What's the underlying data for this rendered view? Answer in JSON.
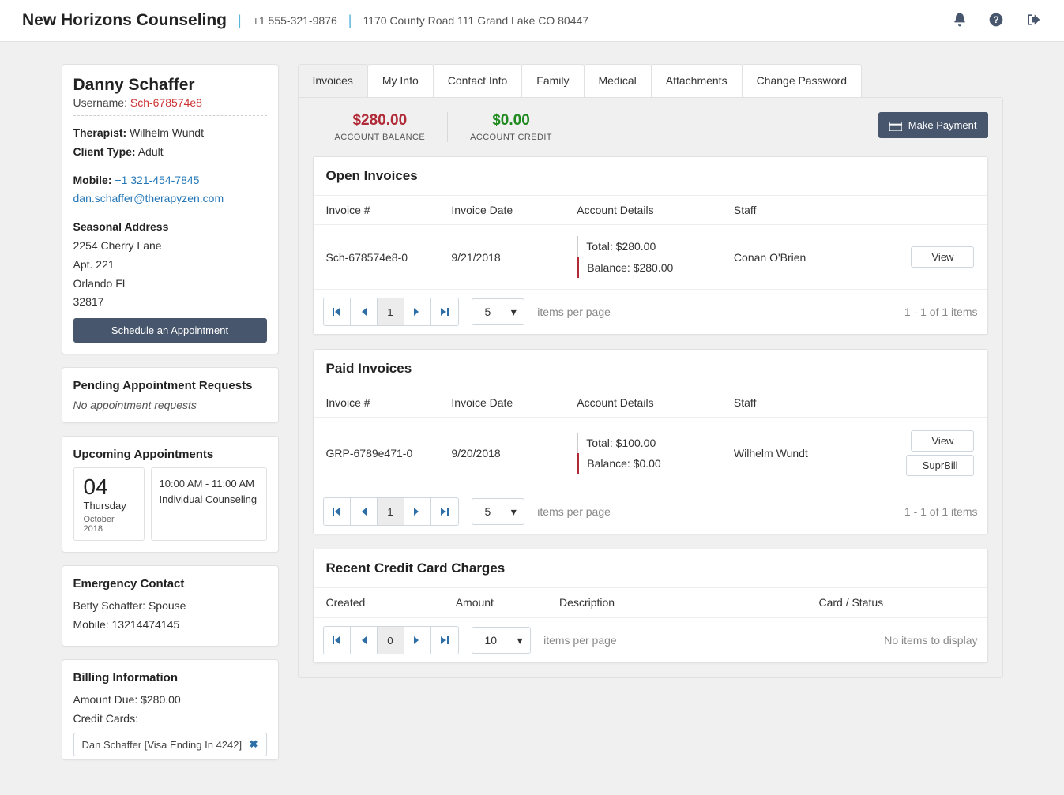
{
  "header": {
    "brand": "New Horizons Counseling",
    "phone": "+1 555-321-9876",
    "address": "1170 County Road 111 Grand Lake CO 80447"
  },
  "profile": {
    "name": "Danny Schaffer",
    "username_label": "Username:",
    "username": "Sch-678574e8",
    "therapist_label": "Therapist:",
    "therapist": "Wilhelm Wundt",
    "client_type_label": "Client Type:",
    "client_type": "Adult",
    "mobile_label": "Mobile:",
    "mobile": "+1 321-454-7845",
    "email": "dan.schaffer@therapyzen.com",
    "address_label": "Seasonal Address",
    "addr1": "2254 Cherry Lane",
    "addr2": "Apt. 221",
    "addr3": "Orlando FL",
    "addr4": "32817",
    "schedule_btn": "Schedule an Appointment"
  },
  "pending": {
    "title": "Pending Appointment Requests",
    "empty": "No appointment requests"
  },
  "upcoming": {
    "title": "Upcoming Appointments",
    "day_num": "04",
    "day_name": "Thursday",
    "month": "October 2018",
    "time": "10:00 AM - 11:00 AM",
    "type": "Individual Counseling"
  },
  "emergency": {
    "title": "Emergency Contact",
    "line1": "Betty Schaffer: Spouse",
    "line2": "Mobile: 13214474145"
  },
  "billing": {
    "title": "Billing Information",
    "due": "Amount Due: $280.00",
    "cc_label": "Credit Cards:",
    "cc1": "Dan Schaffer [Visa Ending In 4242]"
  },
  "tabs": {
    "invoices": "Invoices",
    "myinfo": "My Info",
    "contact": "Contact Info",
    "family": "Family",
    "medical": "Medical",
    "attachments": "Attachments",
    "changepw": "Change Password"
  },
  "balances": {
    "balance_amt": "$280.00",
    "balance_lbl": "ACCOUNT BALANCE",
    "credit_amt": "$0.00",
    "credit_lbl": "ACCOUNT CREDIT",
    "make_payment": "Make Payment"
  },
  "open_invoices": {
    "title": "Open Invoices",
    "h1": "Invoice #",
    "h2": "Invoice Date",
    "h3": "Account Details",
    "h4": "Staff",
    "row": {
      "num": "Sch-678574e8-0",
      "date": "9/21/2018",
      "total": "Total: $280.00",
      "balance": "Balance: $280.00",
      "staff": "Conan O'Brien",
      "view": "View"
    },
    "page_current": "1",
    "ppp": "5",
    "ipp": "items per page",
    "info": "1 - 1 of 1 items"
  },
  "paid_invoices": {
    "title": "Paid Invoices",
    "h1": "Invoice #",
    "h2": "Invoice Date",
    "h3": "Account Details",
    "h4": "Staff",
    "row": {
      "num": "GRP-6789e471-0",
      "date": "9/20/2018",
      "total": "Total: $100.00",
      "balance": "Balance: $0.00",
      "staff": "Wilhelm Wundt",
      "view": "View",
      "supr": "SuprBill"
    },
    "page_current": "1",
    "ppp": "5",
    "ipp": "items per page",
    "info": "1 - 1 of 1 items"
  },
  "cc_charges": {
    "title": "Recent Credit Card Charges",
    "h1": "Created",
    "h2": "Amount",
    "h3": "Description",
    "h4": "Card / Status",
    "page_current": "0",
    "ppp": "10",
    "ipp": "items per page",
    "info": "No items to display"
  }
}
